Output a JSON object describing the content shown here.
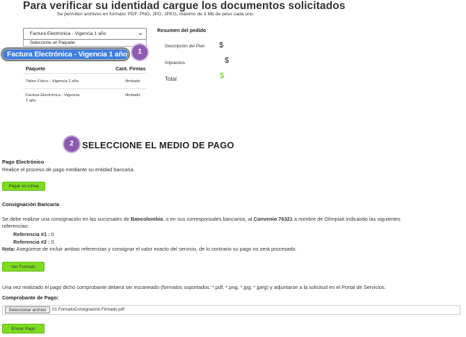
{
  "header": {
    "title": "Para verificar su identidad cargue los documentos solicitados",
    "subtitle": "Se permiten archivos en formato: PDF, PNG, JPG, JPEG, máximo de 3 Mb de peso cada uno."
  },
  "package_select": {
    "selected": "Factura Electrónica - Vigencia 1 año",
    "dropdown_option": "Seleccione un Paquete",
    "highlighted_option": "Factura Electrónica - Vigencia 1 año",
    "step_badge": "1"
  },
  "package_table": {
    "headers": [
      "Paquete",
      "Cant. Firmas"
    ],
    "rows": [
      {
        "paquete": "Token Físico - Vigencia 2 año",
        "firmas": "Ilimitado"
      },
      {
        "paquete_line1": "Factura Electrónica - Vigencia",
        "paquete_line2": "1 año",
        "firmas": "Ilimitado"
      }
    ]
  },
  "order_summary": {
    "title": "Resumen del pedido",
    "items": [
      {
        "label": "Descripción del Plan",
        "value": "$"
      },
      {
        "label": "Impuestos",
        "value": "$"
      },
      {
        "label": "Total",
        "value": "$"
      }
    ],
    "total_color": "#5bd000"
  },
  "payment": {
    "step_badge": "2",
    "title": "SELECCIONE EL MEDIO DE PAGO",
    "electronic": {
      "title": "Pago Electrónico",
      "description": "Realice el proceso de pago mediante su entidad bancaria.",
      "button": "Pagar en Línea"
    },
    "deposit": {
      "title": "Consignación Bancaria",
      "text_pre": "Se debe realizar una consignación en las sucursales de ",
      "bank": "Bancolombia",
      "text_mid": ", o en sus corresponsales bancarios, al ",
      "agreement": "Convenio 76321",
      "text_post": " a nombre de Olimpiait indicando las siguientes",
      "text_line2": "referencias:",
      "ref1_label": "Referencia #1 :",
      "ref1_value": " 0",
      "ref2_label": "Referencia #2 :",
      "ref2_value": " 0",
      "note_label": "Nota:",
      "note_text": " Asegúrese de incluir ambas referencias y consignar el valor exacto del servicio, de lo contrario su pago no será procesado.",
      "button": "Ver Formato"
    },
    "upload": {
      "instructions": "Una vez realizado el pago dicho comprobante deberá ser escaneado (formatos soportados: *.pdf, *.png, *.jpg, *.jpeg) y adjuntarse a la solicitud en el Portal de Servicios.",
      "label": "Comprobante de Pago:",
      "file_button": "Seleccionar archivo",
      "file_name": "01 FormatoConsignacion.Firmado.pdf",
      "send_button": "Enviar Pago"
    }
  },
  "colors": {
    "accent_green": "#7ddc1f",
    "badge_purple": "#8e5bb0",
    "highlight_blue": "#3d7ee0"
  }
}
